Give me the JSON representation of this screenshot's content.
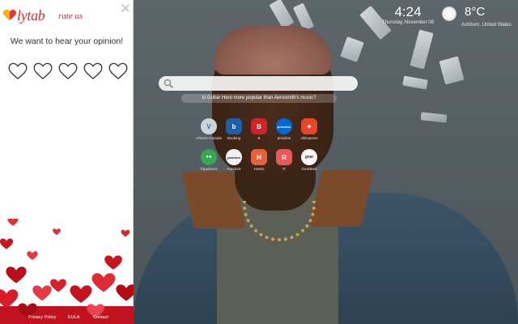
{
  "rating_panel": {
    "brand": "lytab",
    "brand_suffix": "rate us",
    "prompt": "We want to hear your opinion!",
    "stars_total": 5,
    "stars_selected": 0,
    "footer_links": [
      "Privacy Policy",
      "EULA",
      "Contact"
    ]
  },
  "clock": {
    "time": "4:24",
    "date": "Thursday, November 08"
  },
  "weather": {
    "temperature": "8°C",
    "location": "Ashburn, United States",
    "icon": "sun-icon"
  },
  "search": {
    "placeholder": "",
    "suggestion": "Is Guitar Hero more popular than Aerosmith's music?"
  },
  "speed_dial": [
    {
      "name": "vudu",
      "label": "V/Store Canada",
      "icon_text": "V",
      "color": "#c8d6dc"
    },
    {
      "name": "booking",
      "label": "Booking",
      "icon_text": "b",
      "color": "#1e5fa8"
    },
    {
      "name": "b-app",
      "label": "B",
      "icon_text": "B",
      "color": "#d0232a"
    },
    {
      "name": "priceline",
      "label": "priceline",
      "icon_text": "priceline",
      "color": "#0068d6"
    },
    {
      "name": "aliexpress",
      "label": "AliExpress",
      "icon_text": "✦",
      "color": "#e8452b"
    },
    {
      "name": "tripadvisor",
      "label": "Tripadvisor",
      "icon_text": "●●",
      "color": "#34a852"
    },
    {
      "name": "pandora",
      "label": "Pandora",
      "icon_text": "pandora",
      "color": "#f1f1f1"
    },
    {
      "name": "hotels",
      "label": "Hotels",
      "icon_text": "H",
      "color": "#e6603c"
    },
    {
      "name": "r-app",
      "label": "R",
      "icon_text": "R",
      "color": "#e85a5a"
    },
    {
      "name": "gearbest",
      "label": "GearBest",
      "icon_text": "gear",
      "color": "#f7f7f7"
    }
  ]
}
